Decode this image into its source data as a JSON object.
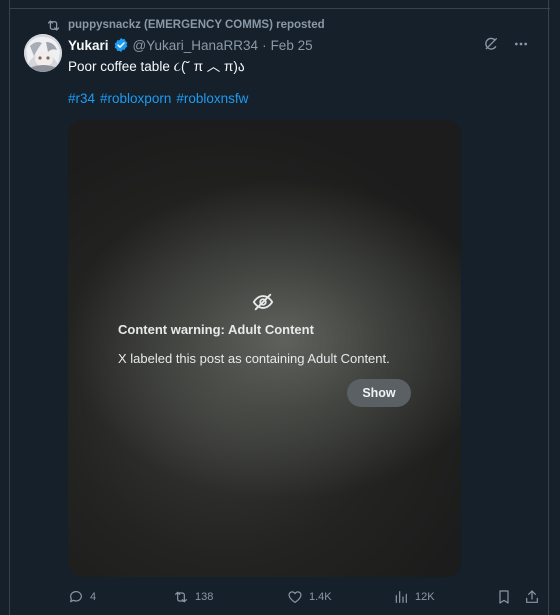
{
  "repost": {
    "icon": "repost-icon",
    "text": "puppysnackz (EMERGENCY COMMS) reposted"
  },
  "tweet": {
    "name": "Yukari",
    "verified_icon": "verified-badge-icon",
    "handle": "@Yukari_HanaRR34",
    "separator": "·",
    "date": "Feb 25",
    "text": "Poor coffee table ૮(˘ π ︿ π)ა",
    "hashtags": [
      "#r34",
      "#robloxporn",
      "#robloxnsfw"
    ]
  },
  "media": {
    "warning_icon": "eye-slash-icon",
    "warning_title": "Content warning: Adult Content",
    "warning_text": "X labeled this post as containing Adult Content.",
    "show_label": "Show"
  },
  "actions": {
    "replies": "4",
    "reposts": "138",
    "likes": "1.4K",
    "views": "12K"
  },
  "colors": {
    "background": "#15202b",
    "accent": "#1d9bf0",
    "secondary_text": "#8b98a5",
    "primary_text": "#f7f9f9"
  }
}
